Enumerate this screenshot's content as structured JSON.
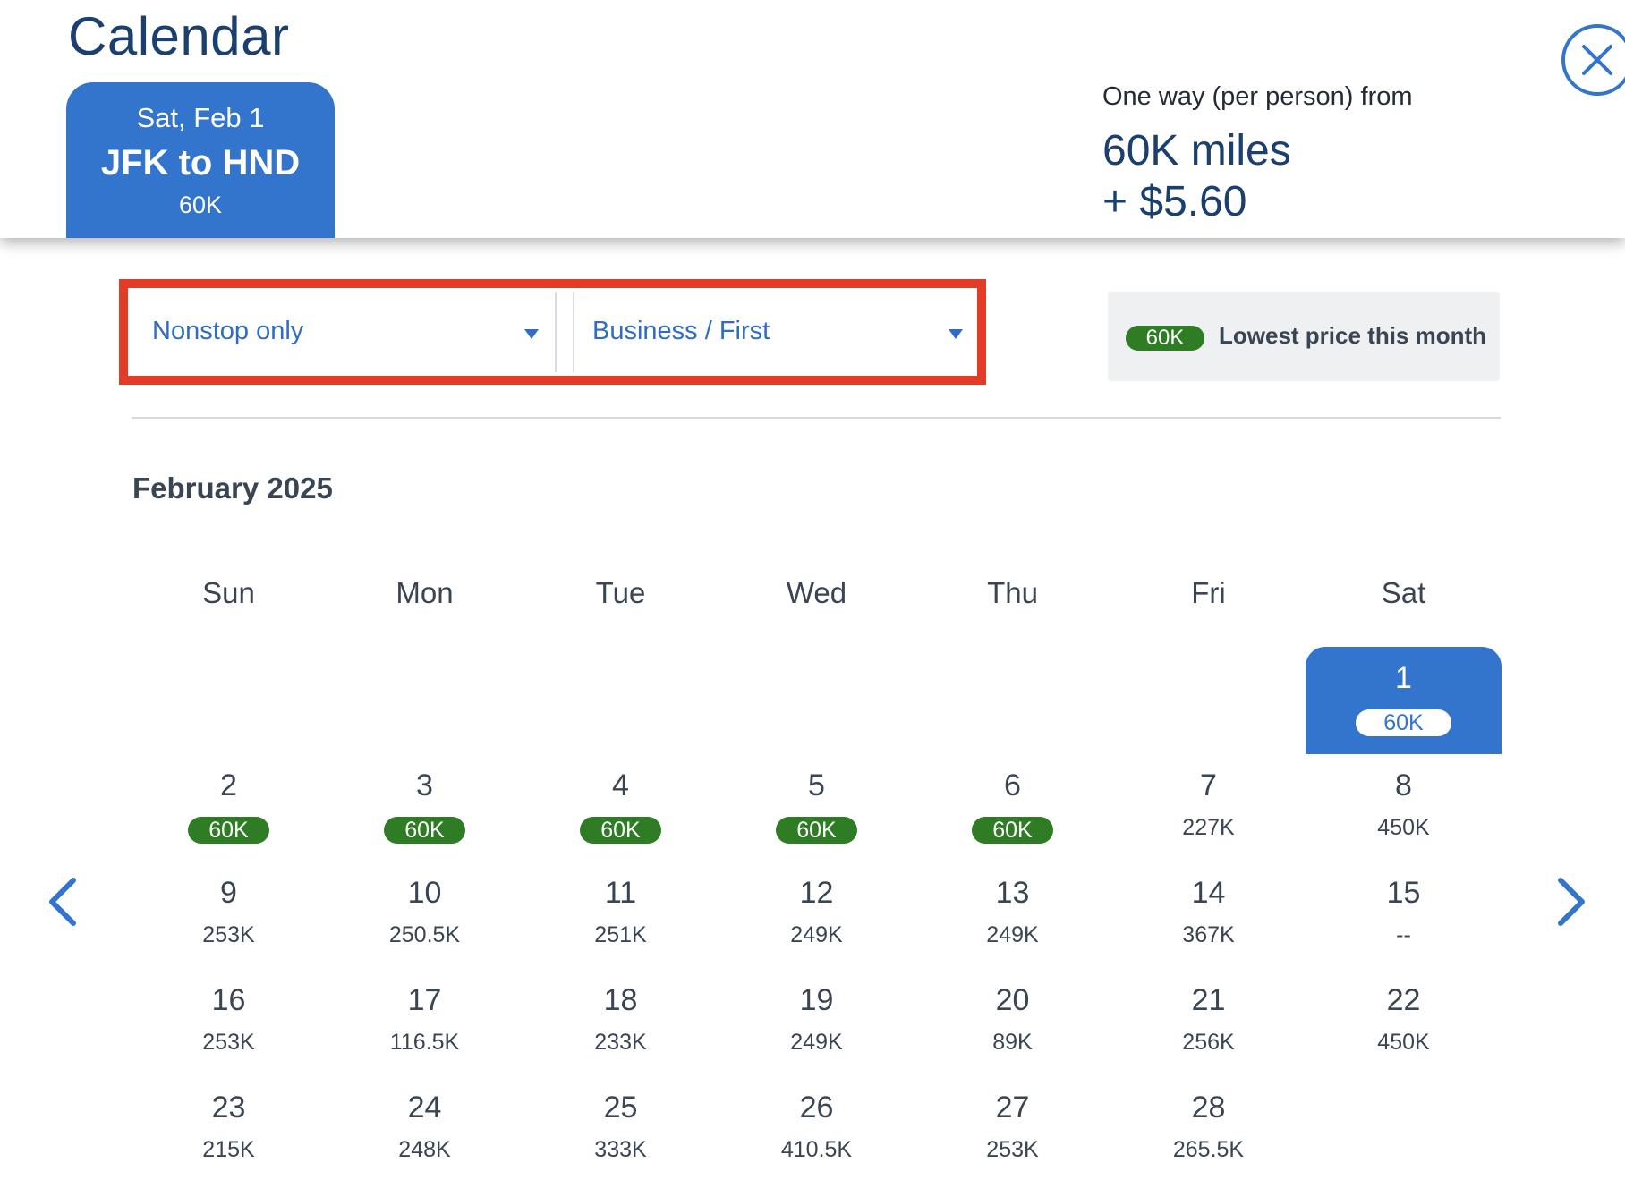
{
  "header": {
    "title": "Calendar",
    "selected_flight": {
      "date": "Sat, Feb 1",
      "route": "JFK to HND",
      "price": "60K"
    },
    "fare": {
      "label": "One way (per person) from",
      "miles": "60K miles",
      "taxes": "+ $5.60"
    }
  },
  "filters": {
    "stops": "Nonstop only",
    "cabin": "Business / First"
  },
  "legend": {
    "badge": "60K",
    "text": "Lowest price this month"
  },
  "month": "February 2025",
  "weekdays": [
    "Sun",
    "Mon",
    "Tue",
    "Wed",
    "Thu",
    "Fri",
    "Sat"
  ],
  "days": [
    {
      "day": "1",
      "price": "60K",
      "lowest": true,
      "selected": true
    },
    {
      "day": "2",
      "price": "60K",
      "lowest": true
    },
    {
      "day": "3",
      "price": "60K",
      "lowest": true
    },
    {
      "day": "4",
      "price": "60K",
      "lowest": true
    },
    {
      "day": "5",
      "price": "60K",
      "lowest": true
    },
    {
      "day": "6",
      "price": "60K",
      "lowest": true
    },
    {
      "day": "7",
      "price": "227K"
    },
    {
      "day": "8",
      "price": "450K"
    },
    {
      "day": "9",
      "price": "253K"
    },
    {
      "day": "10",
      "price": "250.5K"
    },
    {
      "day": "11",
      "price": "251K"
    },
    {
      "day": "12",
      "price": "249K"
    },
    {
      "day": "13",
      "price": "249K"
    },
    {
      "day": "14",
      "price": "367K"
    },
    {
      "day": "15",
      "price": "--"
    },
    {
      "day": "16",
      "price": "253K"
    },
    {
      "day": "17",
      "price": "116.5K"
    },
    {
      "day": "18",
      "price": "233K"
    },
    {
      "day": "19",
      "price": "249K"
    },
    {
      "day": "20",
      "price": "89K"
    },
    {
      "day": "21",
      "price": "256K"
    },
    {
      "day": "22",
      "price": "450K"
    },
    {
      "day": "23",
      "price": "215K"
    },
    {
      "day": "24",
      "price": "248K"
    },
    {
      "day": "25",
      "price": "333K"
    },
    {
      "day": "26",
      "price": "410.5K"
    },
    {
      "day": "27",
      "price": "253K"
    },
    {
      "day": "28",
      "price": "265.5K"
    }
  ],
  "icons": {
    "close": "close-icon",
    "prev": "chevron-left-icon",
    "next": "chevron-right-icon",
    "dropdown": "caret-down-icon"
  },
  "colors": {
    "primary": "#3375cc",
    "heading": "#1b3f6e",
    "link": "#2f6cc3",
    "lowest_badge": "#2e7d24",
    "highlight_box": "#e33b25"
  }
}
